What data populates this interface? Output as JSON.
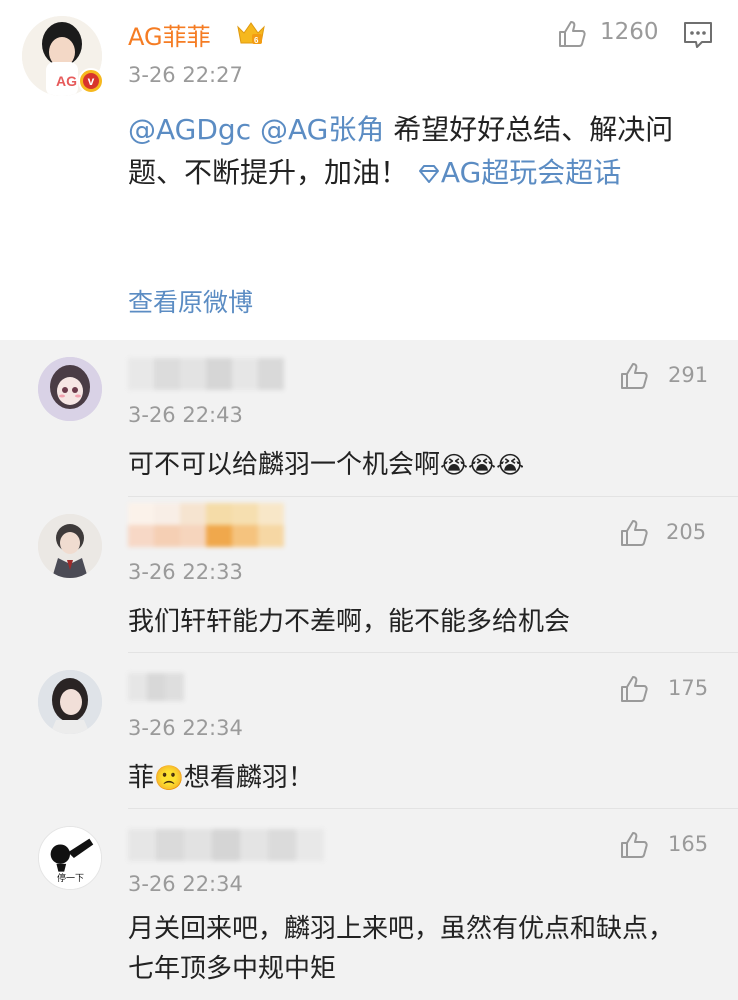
{
  "post": {
    "author": "AG菲菲",
    "time": "3-26 22:27",
    "like_count": "1260",
    "content_mention1": "@AGDgc",
    "content_mention2": "@AG张角",
    "content_text": "希望好好总结、解决问题、不断提升，加油！",
    "topic_label": "AG超玩会超话",
    "view_original": "查看原微博",
    "colors": {
      "author": "#f57c23",
      "link": "#5b8cc3",
      "crown": "#f6b81e",
      "verified": "#d8332c"
    }
  },
  "comments": [
    {
      "time": "3-26 22:43",
      "likes": "291",
      "text_before": "可不可以给麟羽一个机会啊",
      "text_after": "",
      "emoji": [
        "crying-face-icon",
        "crying-face-icon",
        "crying-face-icon"
      ]
    },
    {
      "time": "3-26 22:33",
      "likes": "205",
      "text_before": "我们轩轩能力不差啊，能不能多给机会",
      "text_after": ""
    },
    {
      "time": "3-26 22:34",
      "likes": "175",
      "text_before": "菲",
      "text_after": "想看麟羽！",
      "emoji": [
        "sad-face-icon"
      ]
    },
    {
      "time": "3-26 22:34",
      "likes": "165",
      "text_before": "月关回来吧，麟羽上来吧，虽然有优点和缺点，七年顶多中规中矩",
      "text_after": "",
      "avatar_caption": "停一下"
    }
  ]
}
